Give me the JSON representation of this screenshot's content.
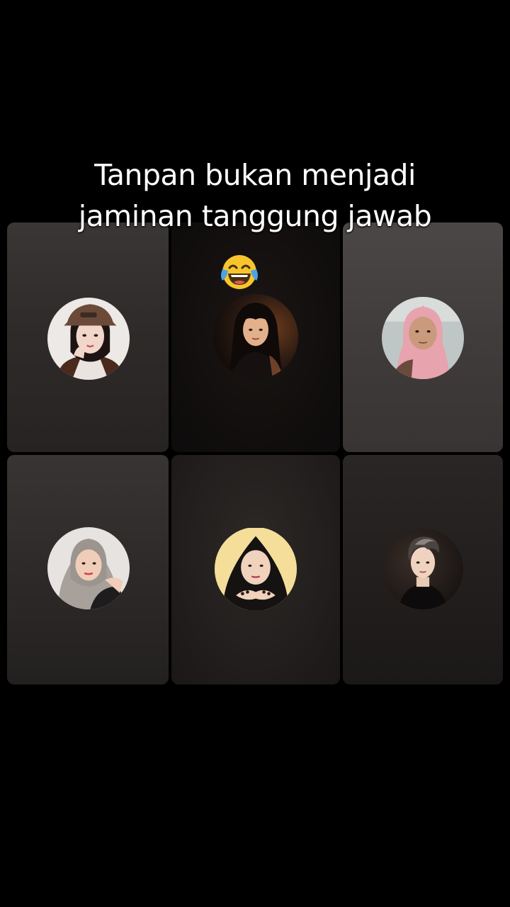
{
  "caption": {
    "line1": "Tanpan bukan menjadi",
    "line2": "jaminan tanggung jawab",
    "emoji": "face-with-tears-of-joy-icon"
  },
  "participants": [
    {
      "slot": 1,
      "avatar": "avatar-woman-cap-icon"
    },
    {
      "slot": 2,
      "avatar": "avatar-woman-dark-hair-icon"
    },
    {
      "slot": 3,
      "avatar": "avatar-woman-pink-hijab-icon"
    },
    {
      "slot": 4,
      "avatar": "avatar-woman-grey-hijab-icon"
    },
    {
      "slot": 5,
      "avatar": "avatar-woman-black-hijab-icon"
    },
    {
      "slot": 6,
      "avatar": "avatar-man-dark-suit-icon"
    }
  ],
  "colors": {
    "background": "#000000",
    "caption_text": "#ffffff",
    "emoji_face": "#f7c52c",
    "emoji_tears": "#4aa3e8"
  }
}
